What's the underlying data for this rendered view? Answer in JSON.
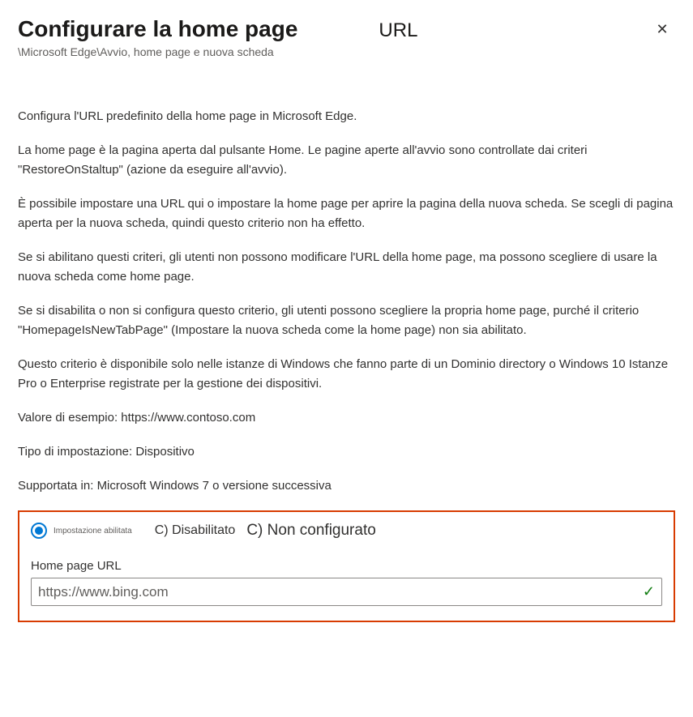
{
  "header": {
    "title": "Configurare la home page",
    "title_suffix": "URL",
    "breadcrumb": "\\Microsoft Edge\\Avvio, home page e nuova scheda"
  },
  "description": {
    "p1": "Configura l'URL predefinito della home page in   Microsoft Edge.",
    "p2": "La home page è la pagina aperta dal pulsante Home. Le pagine aperte all'avvio sono controllate dai criteri \"RestoreOnStaltup\" (azione da eseguire all'avvio).",
    "p3": "È possibile impostare una   URL qui o impostare la home page per aprire la pagina della nuova scheda.        Se scegli di pagina aperta per la nuova scheda, quindi questo criterio non ha effetto.",
    "p4": "Se si abilitano questi criteri, gli utenti non possono modificare l'URL della home page, ma possono scegliere di usare la nuova scheda come home page.",
    "p5": "Se si disabilita o non si configura questo criterio, gli utenti possono scegliere la propria home page, purché il criterio \"HomepageIsNewTabPage\" (Impostare la nuova scheda come la home page) non sia abilitato.",
    "p6": "Questo criterio è disponibile solo nelle istanze di Windows che fanno parte di un Dominio directory o Windows 10       Istanze Pro o Enterprise registrate per la gestione dei dispositivi.",
    "p7": "Valore di esempio: https://www.contoso.com",
    "p8": "Tipo di impostazione: Dispositivo",
    "p9": "Supportata in:   Microsoft Windows 7 o versione successiva"
  },
  "radio": {
    "enabled_label": "Impostazione abilitata",
    "disabled_label": "C) Disabilitato",
    "not_configured_label": "C) Non configurato"
  },
  "input": {
    "label": "Home page URL",
    "value": "https://www.bing.com"
  }
}
